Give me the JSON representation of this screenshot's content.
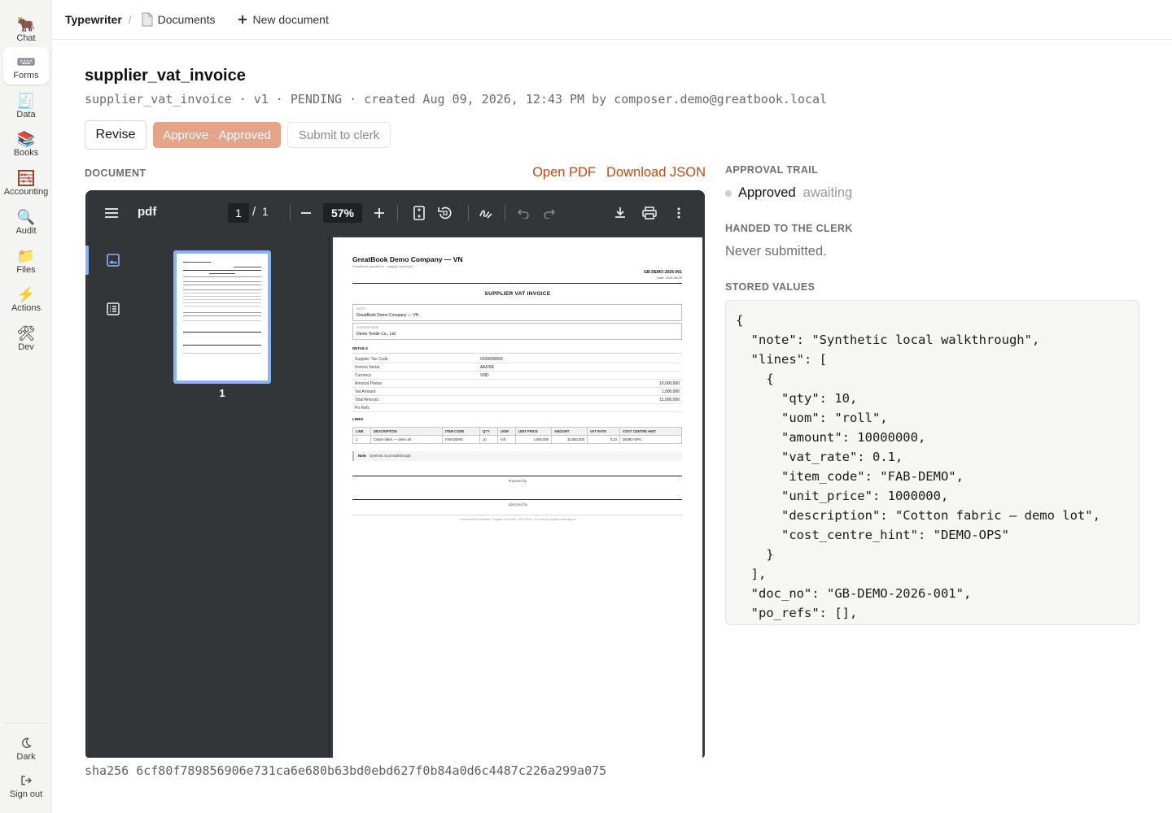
{
  "rail": {
    "items": [
      {
        "label": "Chat",
        "icon": "llama-icon"
      },
      {
        "label": "Forms",
        "icon": "keyboard-icon"
      },
      {
        "label": "Data",
        "icon": "receipt-icon"
      },
      {
        "label": "Books",
        "icon": "books-icon"
      },
      {
        "label": "Accounting",
        "icon": "abacus-icon"
      },
      {
        "label": "Audit",
        "icon": "magnifier-icon"
      },
      {
        "label": "Files",
        "icon": "folder-icon"
      },
      {
        "label": "Actions",
        "icon": "lightning-icon"
      },
      {
        "label": "Dev",
        "icon": "tools-icon"
      }
    ],
    "active": "Forms",
    "bottom": [
      {
        "label": "Dark",
        "icon": "moon-icon"
      },
      {
        "label": "Sign out",
        "icon": "sign-out-icon"
      }
    ]
  },
  "topbar": {
    "brand": "Typewriter",
    "separator": "/",
    "documents": "Documents",
    "new_document": "New document"
  },
  "doc": {
    "title": "supplier_vat_invoice",
    "meta": "supplier_vat_invoice · v1 · PENDING · created Aug 09, 2026, 12:43 PM by composer.demo@greatbook.local",
    "actions": {
      "revise": "Revise",
      "approve": "Approve · Approved",
      "submit": "Submit to clerk"
    },
    "section_label": "DOCUMENT",
    "open_pdf": "Open PDF",
    "download_json": "Download JSON",
    "sha": "sha256 6cf80f789856906e731ca6e680b63bd0ebd627f0b84a0d6c4487c226a299a075"
  },
  "viewer": {
    "name": "pdf",
    "page": "1",
    "slash": "/",
    "total": "1",
    "zoom": "57%",
    "thumb_label": "1",
    "accent": "#8ab4f8"
  },
  "pdf": {
    "company": "GreatBook Demo Company — VN",
    "subtitle": "GreatBook operations · staging document",
    "doc_no": "GB-DEMO-2026-001",
    "date": "Date: 2026-08-09",
    "heading": "SUPPLIER VAT INVOICE",
    "entity_label": "ENTITY",
    "entity": "GreatBook Demo Company — VN",
    "supplier_label": "SUPPLIER NAME",
    "supplier": "Demo Textile Co., Ltd",
    "details_label": "DETAILS",
    "details": [
      {
        "k": "Supplier Tax Code",
        "v": "0100000000"
      },
      {
        "k": "Invoice Serial",
        "v": "AA/26E"
      },
      {
        "k": "Currency",
        "v": "VND"
      },
      {
        "k": "Amount Pretax",
        "v": "10,000,000"
      },
      {
        "k": "Vat Amount",
        "v": "1,000,000"
      },
      {
        "k": "Total Amount",
        "v": "11,000,000"
      },
      {
        "k": "Po Refs",
        "v": ""
      }
    ],
    "lines_label": "LINES",
    "lines_headers": [
      "LINE",
      "DESCRIPTION",
      "ITEM CODE",
      "QTY",
      "UOM",
      "UNIT PRICE",
      "AMOUNT",
      "VAT RATE",
      "COST CENTRE HINT"
    ],
    "lines_rows": [
      [
        "1",
        "Cotton fabric — demo lot",
        "FAB-DEMO",
        "10",
        "roll",
        "1,000,000",
        "10,000,000",
        "0.10",
        "DEMO-OPS"
      ]
    ],
    "note_label": "Note:",
    "note": "Synthetic local walkthrough",
    "prepared_by": "Prepared by",
    "approved_by": "Approved by",
    "footer": "Generated from GreatBook · Supplier Vat Invoice · 2026-08-09 · not a statutory original unless signed"
  },
  "side": {
    "approval_trail_label": "APPROVAL TRAIL",
    "trail_status": "Approved",
    "trail_state": "awaiting",
    "handed_label": "HANDED TO THE CLERK",
    "handed_value": "Never submitted.",
    "stored_label": "STORED VALUES",
    "stored_json": "{\n  \"note\": \"Synthetic local walkthrough\",\n  \"lines\": [\n    {\n      \"qty\": 10,\n      \"uom\": \"roll\",\n      \"amount\": 10000000,\n      \"vat_rate\": 0.1,\n      \"item_code\": \"FAB-DEMO\",\n      \"unit_price\": 1000000,\n      \"description\": \"Cotton fabric — demo lot\",\n      \"cost_centre_hint\": \"DEMO-OPS\"\n    }\n  ],\n  \"doc_no\": \"GB-DEMO-2026-001\",\n  \"po_refs\": [],"
  },
  "colors": {
    "accent_link": "#c24a13",
    "approve_button": "#e3a48a",
    "viewer_toolbar": "#323639",
    "viewer_bg": "#38383d"
  }
}
